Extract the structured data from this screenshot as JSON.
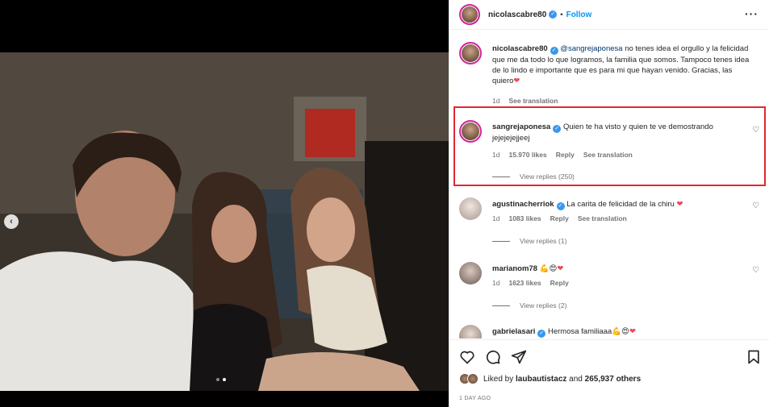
{
  "post": {
    "media": {
      "slide_index": 2,
      "slide_count": 2
    },
    "header": {
      "username": "nicolascabre80",
      "follow_label": "Follow",
      "separator": "•"
    },
    "caption": {
      "username": "nicolascabre80",
      "mention": "@sangrejaponesa",
      "text": " no tenes idea el orgullo y la felicidad que me da todo lo que logramos, la familia que somos. Tampoco tenes idea de lo lindo e importante que es para mi que hayan venido. Gracias, las quiero",
      "time": "1d",
      "see_translation": "See translation"
    },
    "comments": [
      {
        "username": "sangrejaponesa",
        "text": "Quien te ha visto y quien te ve demostrando jejejejejjeej",
        "time": "1d",
        "likes": "15.970 likes",
        "reply": "Reply",
        "see_translation": "See translation",
        "view_replies": "View replies (250)"
      },
      {
        "username": "agustinacherriok",
        "text": "La carita de felicidad de la chiru",
        "time": "1d",
        "likes": "1083 likes",
        "reply": "Reply",
        "see_translation": "See translation",
        "view_replies": "View replies (1)"
      },
      {
        "username": "marianom78",
        "text": "",
        "time": "1d",
        "likes": "1623 likes",
        "reply": "Reply",
        "view_replies": "View replies (2)"
      },
      {
        "username": "gabrielasari",
        "text": "Hermosa familiaaa"
      }
    ],
    "likes": {
      "prefix": "Liked by ",
      "user": "laubautistacz",
      "middle": " and ",
      "count": "265,937 others"
    },
    "date": "1 DAY AGO",
    "colors": {
      "accent": "#0095f6",
      "highlight": "#e0282f",
      "heart": "#ed4956"
    }
  }
}
